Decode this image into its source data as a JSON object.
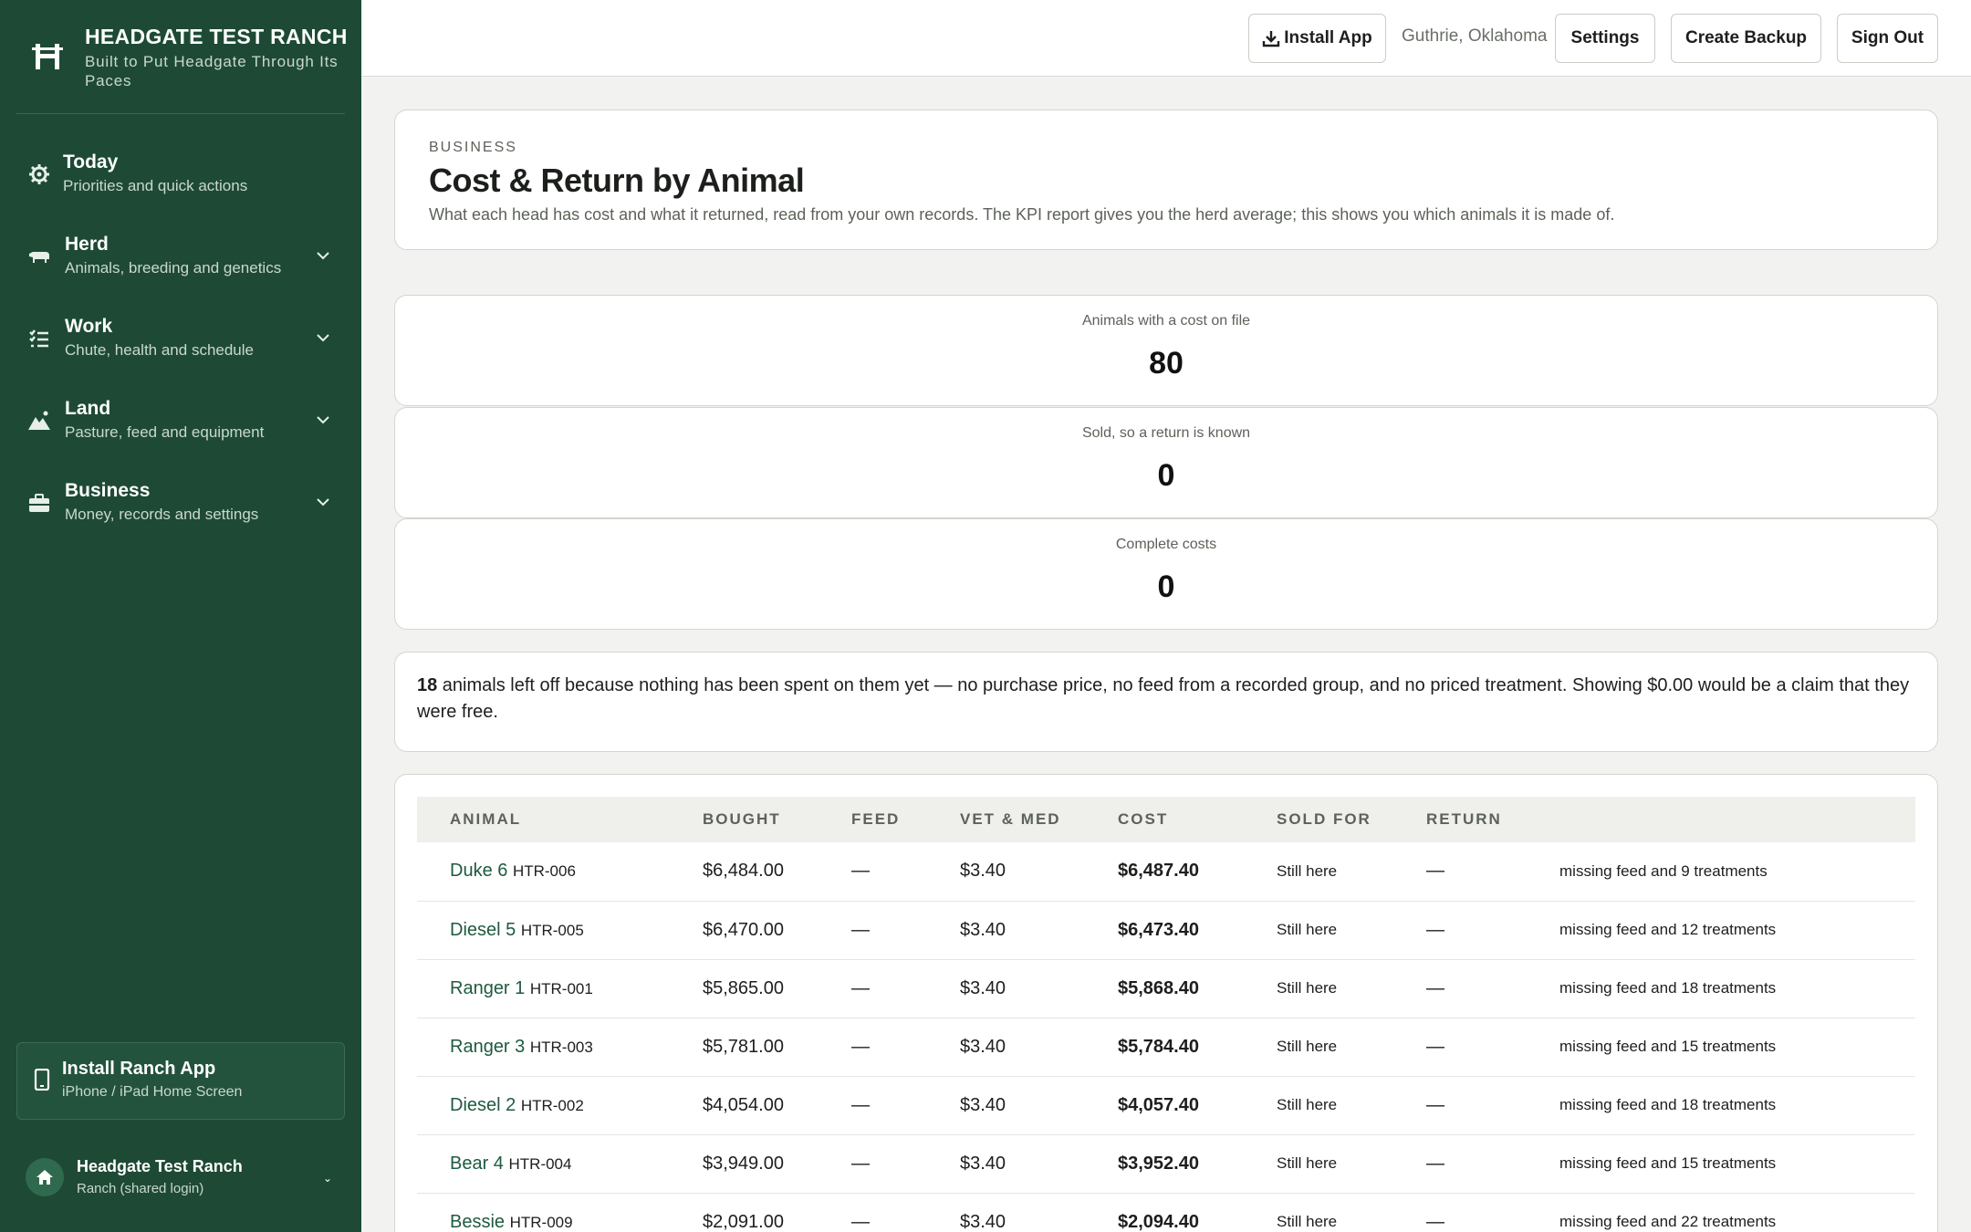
{
  "brand": {
    "title": "HEADGATE TEST RANCH",
    "subtitle": "Built to Put Headgate Through Its Paces"
  },
  "nav": [
    {
      "title": "Today",
      "sub": "Priorities and quick actions",
      "icon": "gear-icon"
    },
    {
      "title": "Herd",
      "sub": "Animals, breeding and genetics",
      "icon": "cow-icon"
    },
    {
      "title": "Work",
      "sub": "Chute, health and schedule",
      "icon": "checklist-icon"
    },
    {
      "title": "Land",
      "sub": "Pasture, feed and equipment",
      "icon": "mountain-icon"
    },
    {
      "title": "Business",
      "sub": "Money, records and settings",
      "icon": "briefcase-icon"
    }
  ],
  "install_card": {
    "title": "Install Ranch App",
    "sub": "iPhone / iPad Home Screen"
  },
  "account": {
    "name": "Headgate Test Ranch",
    "role": "Ranch (shared login)",
    "chevron": "⌄"
  },
  "topbar": {
    "install": "Install App",
    "location": "Guthrie, Oklahoma",
    "settings": "Settings",
    "backup": "Create Backup",
    "signout": "Sign Out"
  },
  "header": {
    "eyebrow": "BUSINESS",
    "title": "Cost & Return by Animal",
    "desc": "What each head has cost and what it returned, read from your own records. The KPI report gives you the herd average; this shows you which animals it is made of."
  },
  "stats": [
    {
      "label": "Animals with a cost on file",
      "value": "80"
    },
    {
      "label": "Sold, so a return is known",
      "value": "0"
    },
    {
      "label": "Complete costs",
      "value": "0"
    }
  ],
  "note": {
    "count": "18",
    "text": " animals left off because nothing has been spent on them yet — no purchase price, no feed from a recorded group, and no priced treatment. Showing $0.00 would be a claim that they were free."
  },
  "table": {
    "headers": [
      "ANIMAL",
      "BOUGHT",
      "FEED",
      "VET & MED",
      "COST",
      "SOLD FOR",
      "RETURN",
      ""
    ],
    "rows": [
      {
        "name": "Duke 6",
        "tag": "HTR-006",
        "bought": "$6,484.00",
        "feed": "—",
        "vet": "$3.40",
        "cost": "$6,487.40",
        "sold": "Still here",
        "ret": "—",
        "note": "missing feed and 9 treatments"
      },
      {
        "name": "Diesel 5",
        "tag": "HTR-005",
        "bought": "$6,470.00",
        "feed": "—",
        "vet": "$3.40",
        "cost": "$6,473.40",
        "sold": "Still here",
        "ret": "—",
        "note": "missing feed and 12 treatments"
      },
      {
        "name": "Ranger 1",
        "tag": "HTR-001",
        "bought": "$5,865.00",
        "feed": "—",
        "vet": "$3.40",
        "cost": "$5,868.40",
        "sold": "Still here",
        "ret": "—",
        "note": "missing feed and 18 treatments"
      },
      {
        "name": "Ranger 3",
        "tag": "HTR-003",
        "bought": "$5,781.00",
        "feed": "—",
        "vet": "$3.40",
        "cost": "$5,784.40",
        "sold": "Still here",
        "ret": "—",
        "note": "missing feed and 15 treatments"
      },
      {
        "name": "Diesel 2",
        "tag": "HTR-002",
        "bought": "$4,054.00",
        "feed": "—",
        "vet": "$3.40",
        "cost": "$4,057.40",
        "sold": "Still here",
        "ret": "—",
        "note": "missing feed and 18 treatments"
      },
      {
        "name": "Bear 4",
        "tag": "HTR-004",
        "bought": "$3,949.00",
        "feed": "—",
        "vet": "$3.40",
        "cost": "$3,952.40",
        "sold": "Still here",
        "ret": "—",
        "note": "missing feed and 15 treatments"
      },
      {
        "name": "Bessie",
        "tag": "HTR-009",
        "bought": "$2,091.00",
        "feed": "—",
        "vet": "$3.40",
        "cost": "$2,094.40",
        "sold": "Still here",
        "ret": "—",
        "note": "missing feed and 22 treatments"
      }
    ]
  },
  "colors": {
    "sidebar": "#1e4a35",
    "accent_link": "#1e5a3f",
    "background": "#f2f3f0"
  }
}
